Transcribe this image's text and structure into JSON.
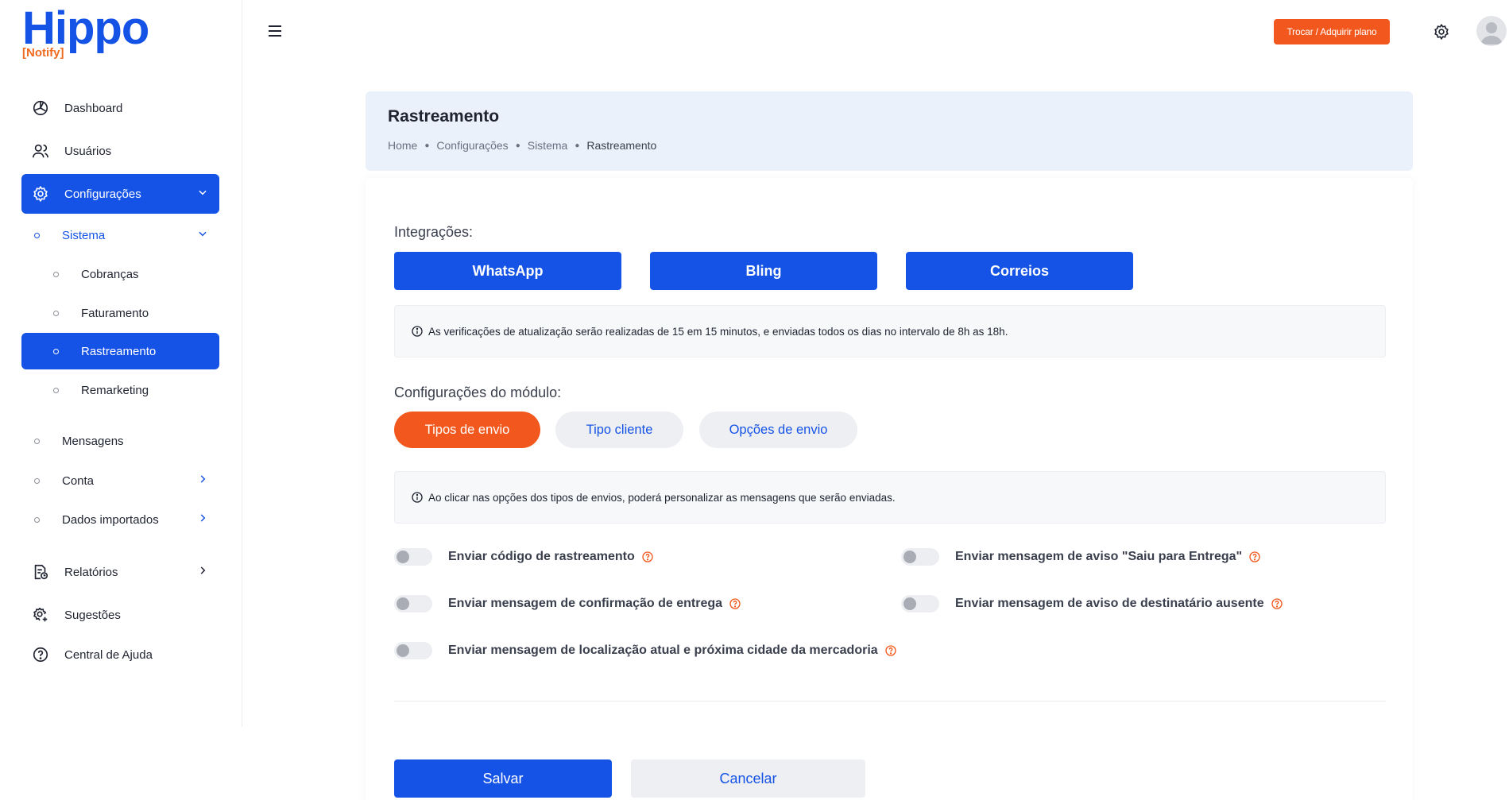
{
  "brand": {
    "name": "Hippo",
    "sub": "[Notify]",
    "accent": "#1553e6",
    "orange": "#f2581d"
  },
  "topbar": {
    "plan_button": "Trocar / Adquirir plano",
    "icons": [
      "menu-icon",
      "gear-icon",
      "avatar"
    ]
  },
  "sidebar": {
    "dashboard": "Dashboard",
    "usuarios": "Usuários",
    "configuracoes": "Configurações",
    "sistema": "Sistema",
    "cobrancas": "Cobranças",
    "faturamento": "Faturamento",
    "rastreamento": "Rastreamento",
    "remarketing": "Remarketing",
    "mensagens": "Mensagens",
    "conta": "Conta",
    "dados_importados": "Dados importados",
    "relatorios": "Relatórios",
    "sugestoes": "Sugestões",
    "central_ajuda": "Central de Ajuda"
  },
  "header": {
    "title": "Rastreamento",
    "breadcrumb": [
      "Home",
      "Configurações",
      "Sistema",
      "Rastreamento"
    ]
  },
  "integrations": {
    "label": "Integrações:",
    "buttons": [
      "WhatsApp",
      "Bling",
      "Correios"
    ],
    "info": "As verificações de atualização serão realizadas de 15 em 15 minutos, e enviadas todos os dias no intervalo de 8h as 18h."
  },
  "module": {
    "label": "Configurações do módulo:",
    "tabs": [
      "Tipos de envio",
      "Tipo cliente",
      "Opções de envio"
    ],
    "active_tab": "Tipos de envio",
    "info": "Ao clicar nas opções dos tipos de envios, poderá personalizar as mensagens que serão enviadas."
  },
  "toggles": {
    "t1": {
      "label": "Enviar código de rastreamento",
      "on": false
    },
    "t2": {
      "label": "Enviar mensagem de aviso \"Saiu para Entrega\"",
      "on": false
    },
    "t3": {
      "label": "Enviar mensagem de confirmação de entrega",
      "on": false
    },
    "t4": {
      "label": "Enviar mensagem de aviso de destinatário ausente",
      "on": false
    },
    "t5": {
      "label": "Enviar mensagem de localização atual e próxima cidade da mercadoria",
      "on": false
    }
  },
  "actions": {
    "save": "Salvar",
    "cancel": "Cancelar"
  }
}
